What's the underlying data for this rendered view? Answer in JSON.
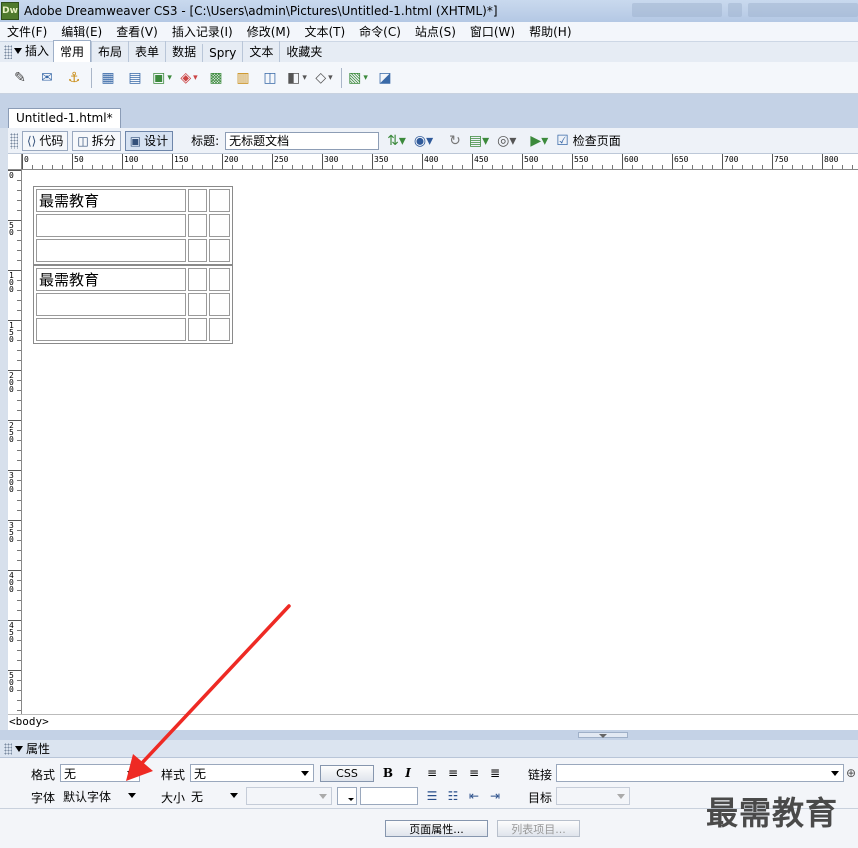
{
  "window": {
    "app_badge": "Dw",
    "title": "Adobe Dreamweaver CS3 - [C:\\Users\\admin\\Pictures\\Untitled-1.html (XHTML)*]"
  },
  "menu": [
    "文件(F)",
    "编辑(E)",
    "查看(V)",
    "插入记录(I)",
    "修改(M)",
    "文本(T)",
    "命令(C)",
    "站点(S)",
    "窗口(W)",
    "帮助(H)"
  ],
  "insert_panel": {
    "title": "插入",
    "tabs": [
      "常用",
      "布局",
      "表单",
      "数据",
      "Spry",
      "文本",
      "收藏夹"
    ],
    "active_tab": "常用"
  },
  "document": {
    "tab_label": "Untitled-1.html*",
    "view_buttons": {
      "code": "代码",
      "split": "拆分",
      "design": "设计"
    },
    "title_label": "标题:",
    "title_value": "无标题文档",
    "check_page": "检查页面"
  },
  "ruler": {
    "h_labels": [
      "0",
      "50",
      "100",
      "150",
      "200",
      "250",
      "300",
      "350",
      "400",
      "450",
      "500",
      "550",
      "600",
      "650",
      "700",
      "750",
      "800"
    ],
    "v_labels": [
      "0",
      "50",
      "100",
      "150",
      "200",
      "250",
      "300",
      "350",
      "400",
      "450",
      "500"
    ]
  },
  "tables": [
    {
      "rows": [
        [
          "最需教育",
          "",
          ""
        ],
        [
          "",
          "",
          ""
        ],
        [
          "",
          "",
          ""
        ]
      ]
    },
    {
      "rows": [
        [
          "最需教育",
          "",
          ""
        ],
        [
          "",
          "",
          ""
        ],
        [
          "",
          "",
          ""
        ]
      ]
    }
  ],
  "tag_selector": "<body>",
  "properties": {
    "title": "属性",
    "format_label": "格式",
    "format_value": "无",
    "style_label": "样式",
    "style_value": "无",
    "css_button": "CSS",
    "bold": "B",
    "italic": "I",
    "link_label": "链接",
    "font_label": "字体",
    "font_value": "默认字体",
    "size_label": "大小",
    "size_value": "无",
    "target_label": "目标",
    "page_props_button": "页面属性...",
    "list_item_button": "列表项目..."
  },
  "watermark": "最需教育",
  "colors": {
    "arrow": "#ee2a24",
    "accent": "#6e86aa"
  }
}
